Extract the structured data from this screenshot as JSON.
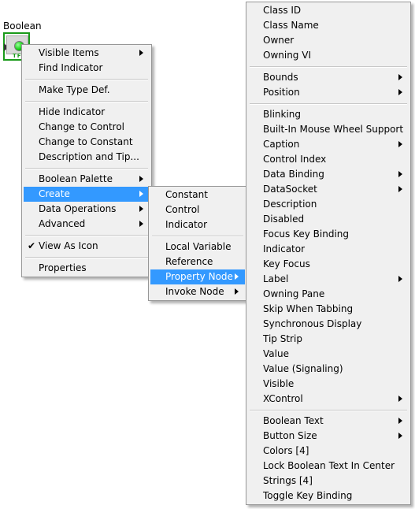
{
  "control": {
    "label": "Boolean",
    "terminal_text": "TF"
  },
  "menu1": [
    {
      "label": "Visible Items",
      "submenu": true
    },
    {
      "label": "Find Indicator"
    },
    {
      "sep": true
    },
    {
      "label": "Make Type Def."
    },
    {
      "sep": true
    },
    {
      "label": "Hide Indicator"
    },
    {
      "label": "Change to Control"
    },
    {
      "label": "Change to Constant"
    },
    {
      "label": "Description and Tip..."
    },
    {
      "sep": true
    },
    {
      "label": "Boolean Palette",
      "submenu": true
    },
    {
      "label": "Create",
      "submenu": true,
      "highlighted": true
    },
    {
      "label": "Data Operations",
      "submenu": true
    },
    {
      "label": "Advanced",
      "submenu": true
    },
    {
      "sep": true
    },
    {
      "label": "View As Icon",
      "checked": true
    },
    {
      "sep": true
    },
    {
      "label": "Properties"
    }
  ],
  "menu2": [
    {
      "label": "Constant"
    },
    {
      "label": "Control"
    },
    {
      "label": "Indicator"
    },
    {
      "sep": true
    },
    {
      "label": "Local Variable"
    },
    {
      "label": "Reference"
    },
    {
      "label": "Property Node",
      "submenu": true,
      "highlighted": true
    },
    {
      "label": "Invoke Node",
      "submenu": true
    }
  ],
  "menu3": [
    {
      "label": "Class ID"
    },
    {
      "label": "Class Name"
    },
    {
      "label": "Owner"
    },
    {
      "label": "Owning VI"
    },
    {
      "sep": true
    },
    {
      "label": "Bounds",
      "submenu": true
    },
    {
      "label": "Position",
      "submenu": true
    },
    {
      "sep": true
    },
    {
      "label": "Blinking"
    },
    {
      "label": "Built-In Mouse Wheel Support"
    },
    {
      "label": "Caption",
      "submenu": true
    },
    {
      "label": "Control Index"
    },
    {
      "label": "Data Binding",
      "submenu": true
    },
    {
      "label": "DataSocket",
      "submenu": true
    },
    {
      "label": "Description"
    },
    {
      "label": "Disabled"
    },
    {
      "label": "Focus Key Binding"
    },
    {
      "label": "Indicator"
    },
    {
      "label": "Key Focus"
    },
    {
      "label": "Label",
      "submenu": true
    },
    {
      "label": "Owning Pane"
    },
    {
      "label": "Skip When Tabbing"
    },
    {
      "label": "Synchronous Display"
    },
    {
      "label": "Tip Strip"
    },
    {
      "label": "Value"
    },
    {
      "label": "Value (Signaling)"
    },
    {
      "label": "Visible"
    },
    {
      "label": "XControl",
      "submenu": true
    },
    {
      "sep": true
    },
    {
      "label": "Boolean Text",
      "submenu": true
    },
    {
      "label": "Button Size",
      "submenu": true
    },
    {
      "label": "Colors [4]"
    },
    {
      "label": "Lock Boolean Text In Center"
    },
    {
      "label": "Strings [4]"
    },
    {
      "label": "Toggle Key Binding"
    }
  ],
  "colors": {
    "highlight": "#3399ff",
    "menu_bg": "#f0f0f0",
    "terminal": "#1a9a1a"
  }
}
